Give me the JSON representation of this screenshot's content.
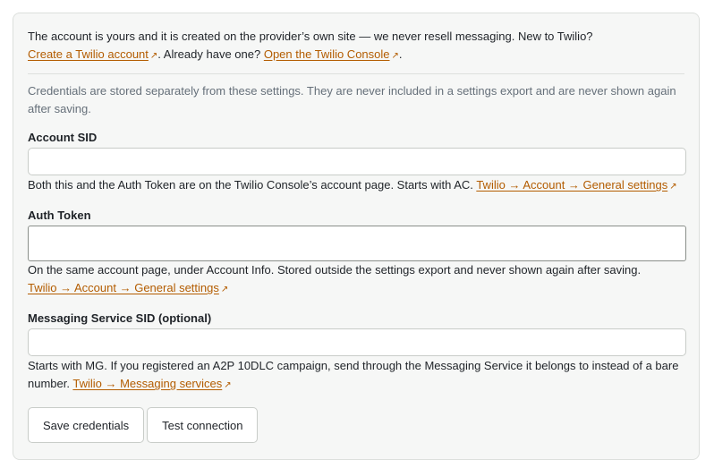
{
  "intro": {
    "text_before": "The account is yours and it is created on the provider’s own site — we never resell messaging. New to Twilio?",
    "create_link": "Create a Twilio account",
    "text_middle": ". Already have one?",
    "console_link": "Open the Twilio Console",
    "text_end": "."
  },
  "credentials_note": "Credentials are stored separately from these settings. They are never included in a settings export and are never shown again after saving.",
  "fields": {
    "account_sid": {
      "label": "Account SID",
      "value": "",
      "hint": "Both this and the Auth Token are on the Twilio Console’s account page. Starts with AC.",
      "link": "Twilio → Account → General settings"
    },
    "auth_token": {
      "label": "Auth Token",
      "value": "",
      "hint": "On the same account page, under Account Info. Stored outside the settings export and never shown again after saving.",
      "link": "Twilio → Account → General settings"
    },
    "messaging_service_sid": {
      "label": "Messaging Service SID (optional)",
      "value": "",
      "hint": "Starts with MG. If you registered an A2P 10DLC campaign, send through the Messaging Service it belongs to instead of a bare number.",
      "link": "Twilio → Messaging services"
    }
  },
  "buttons": {
    "save": "Save credentials",
    "test": "Test connection"
  },
  "icons": {
    "external_link": "external-link-icon"
  },
  "colors": {
    "link": "#b35c00",
    "muted_text": "#66707a",
    "card_background": "#f6f7f6"
  }
}
